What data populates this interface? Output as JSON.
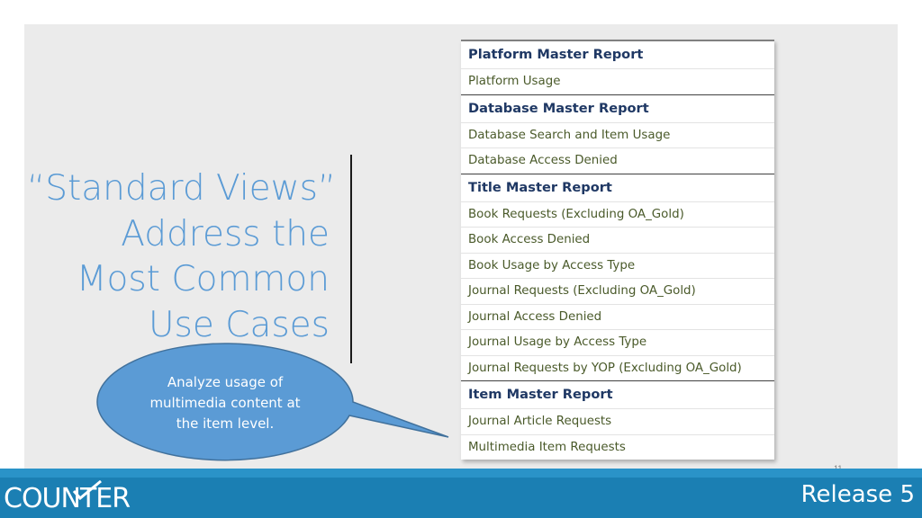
{
  "title_lines": [
    "“Standard Views”",
    "Address the",
    "Most Common",
    "Use Cases"
  ],
  "callout": {
    "lines": [
      "Analyze usage of",
      "multimedia content at",
      "the item level."
    ]
  },
  "table": {
    "sections": [
      {
        "header": "Platform Master Report",
        "rows": [
          "Platform Usage"
        ]
      },
      {
        "header": "Database Master Report",
        "rows": [
          "Database Search and Item Usage",
          "Database Access Denied"
        ]
      },
      {
        "header": "Title Master Report",
        "rows": [
          "Book Requests (Excluding OA_Gold)",
          "Book Access Denied",
          "Book Usage by Access Type",
          "Journal Requests (Excluding OA_Gold)",
          "Journal Access Denied",
          "Journal Usage by Access Type",
          "Journal Requests by YOP (Excluding OA_Gold)"
        ]
      },
      {
        "header": "Item Master Report",
        "rows": [
          "Journal Article Requests",
          "Multimedia Item Requests"
        ]
      }
    ]
  },
  "footer": {
    "brand": "COUNTER",
    "release": "Release 5",
    "page_number": "11"
  },
  "colors": {
    "title": "#5b9bd5",
    "table_header": "#1f3864",
    "table_row": "#4a5a2a",
    "callout_fill": "#5b9bd5",
    "footer": "#1b7fb3"
  }
}
